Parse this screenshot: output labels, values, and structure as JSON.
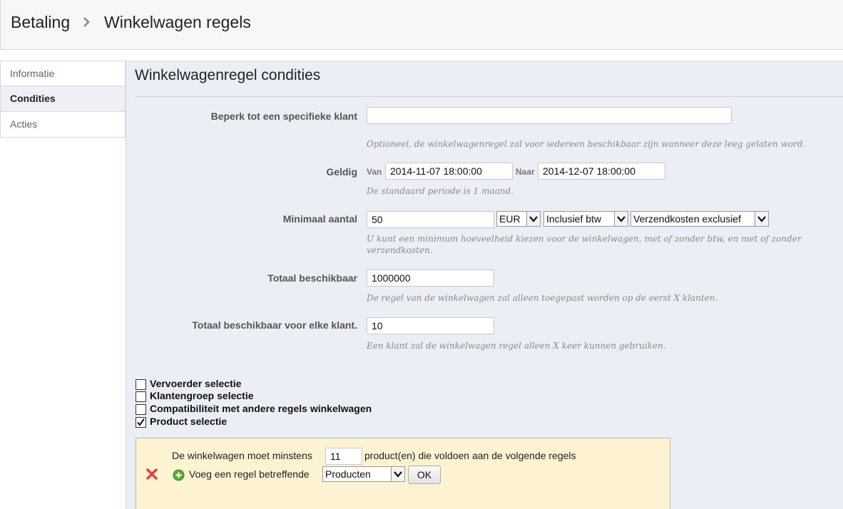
{
  "breadcrumb": {
    "parent": "Betaling",
    "current": "Winkelwagen regels"
  },
  "tabs": [
    {
      "label": "Informatie"
    },
    {
      "label": "Condities"
    },
    {
      "label": "Acties"
    }
  ],
  "panel": {
    "title": "Winkelwagenregel condities"
  },
  "form": {
    "customer": {
      "label": "Beperk tot een specifieke klant",
      "value": "",
      "hint": "Optioneel, de winkelwagenregel zal voor iedereen beschikbaar zijn wanneer deze leeg gelaten word."
    },
    "valid": {
      "label": "Geldig",
      "from_label": "Van",
      "from_value": "2014-11-07 18:00:00",
      "to_label": "Naar",
      "to_value": "2014-12-07 18:00:00",
      "hint": "De standaard periode is 1 maand."
    },
    "minimum": {
      "label": "Minimaal aantal",
      "value": "50",
      "currency": "EUR",
      "tax": "Inclusief btw",
      "shipping": "Verzendkosten exclusief",
      "hint": "U kunt een minimum hoeveelheid kiezen voor de winkelwagen, met of zonder btw, en met of zonder verzendkosten."
    },
    "total": {
      "label": "Totaal beschikbaar",
      "value": "1000000",
      "hint": "De regel van de winkelwagen zal alleen toegepast worden op de eerst X klanten."
    },
    "per_customer": {
      "label": "Totaal beschikbaar voor elke klant.",
      "value": "10",
      "hint": "Een klant zal de winkelwagen regel alleen X keer kunnen gebruiken."
    }
  },
  "checkboxes": [
    {
      "label": "Vervoerder selectie",
      "checked": false
    },
    {
      "label": "Klantengroep selectie",
      "checked": false
    },
    {
      "label": "Compatibiliteit met andere regels winkelwagen",
      "checked": false
    },
    {
      "label": "Product selectie",
      "checked": true
    }
  ],
  "product_rule": {
    "text_before": "De winkelwagen moet minstens",
    "quantity": "11",
    "text_after": "product(en) die voldoen aan de volgende regels",
    "add_label": "Voeg een regel betreffende",
    "type_value": "Producten",
    "ok_label": "OK"
  },
  "colors": {
    "panel_bg": "#ebeef5",
    "rule_box_bg": "#fdf3d1",
    "delete_icon": "#e04040",
    "add_icon": "#5aa832"
  },
  "icons": [
    "chevron-right-icon",
    "dropdown-arrow-icon",
    "checkmark-icon",
    "delete-x-icon",
    "add-plus-icon"
  ]
}
